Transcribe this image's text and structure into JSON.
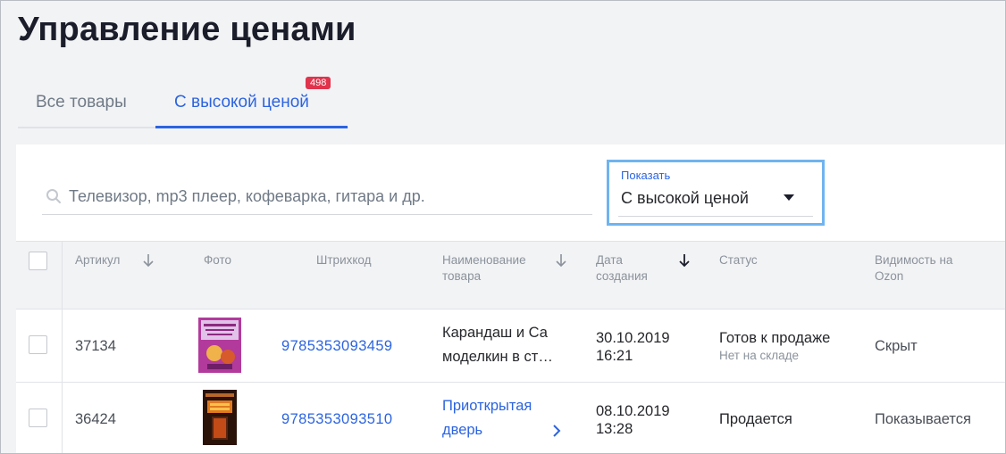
{
  "page": {
    "title": "Управление ценами"
  },
  "tabs": [
    {
      "label": "Все товары",
      "active": false
    },
    {
      "label": "С высокой ценой",
      "active": true,
      "badge": "498"
    }
  ],
  "search": {
    "placeholder": "Телевизор, mp3 плеер, кофеварка, гитара и др.",
    "value": ""
  },
  "filter": {
    "label": "Показать",
    "value": "С высокой ценой"
  },
  "table": {
    "columns": [
      {
        "label": "Артикул",
        "sortable": true
      },
      {
        "label": "Фото",
        "sortable": false
      },
      {
        "label": "Штрихкод",
        "sortable": false
      },
      {
        "label": "Наименование товара",
        "sortable": true
      },
      {
        "label": "Дата создания",
        "sortable": true,
        "active_sort": true
      },
      {
        "label": "Статус",
        "sortable": false
      },
      {
        "label": "Видимость на Ozon",
        "sortable": false
      }
    ],
    "rows": [
      {
        "article": "37134",
        "barcode": "9785353093459",
        "name": "Карандаш и Са моделкин в ст…",
        "date": "30.10.2019",
        "time": "16:21",
        "status": "Готов к продаже",
        "status_sub": "Нет на складе",
        "visibility": "Скрыт"
      },
      {
        "article": "36424",
        "barcode": "9785353093510",
        "name": "Приоткрытая дверь",
        "date": "08.10.2019",
        "time": "13:28",
        "status": "Продается",
        "status_sub": "",
        "visibility": "Показывается"
      }
    ]
  },
  "colors": {
    "accent": "#2c64e0",
    "badge": "#e0334c",
    "focus_border": "#6fb4f0"
  }
}
